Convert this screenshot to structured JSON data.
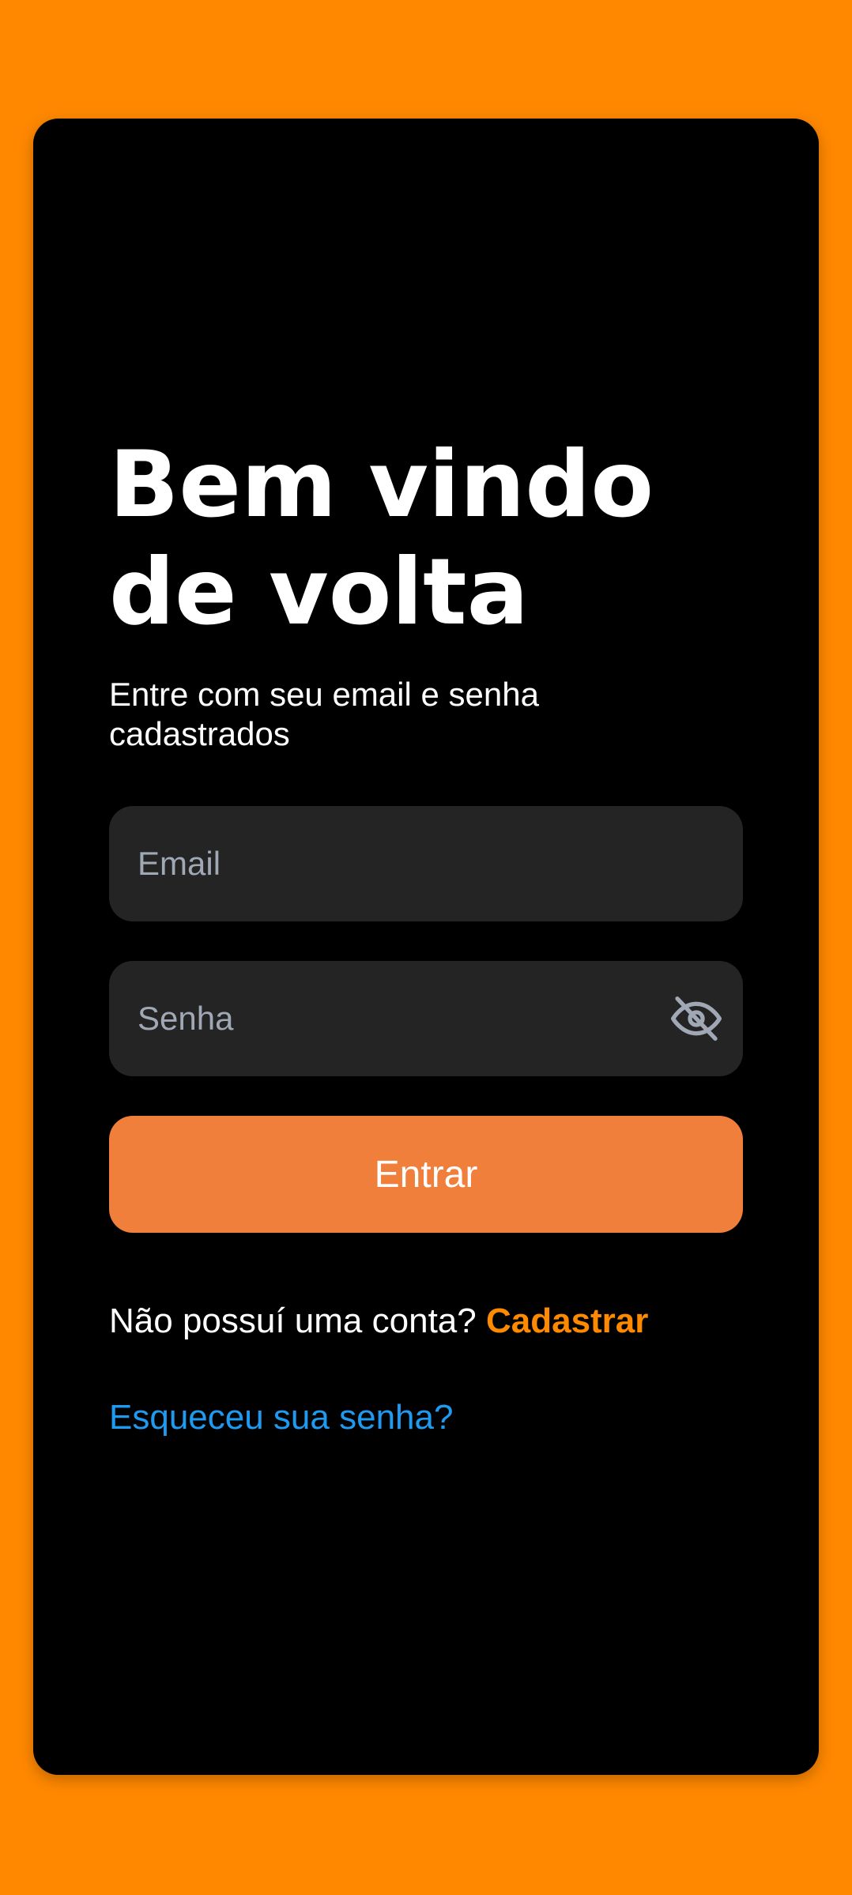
{
  "title": "Bem vindo de volta",
  "subtitle": "Entre com seu email e senha cadastrados",
  "email_field": {
    "placeholder": "Email",
    "value": ""
  },
  "password_field": {
    "placeholder": "Senha",
    "value": "",
    "toggle_icon": "eye-off-icon"
  },
  "login_button": {
    "label": "Entrar"
  },
  "signup": {
    "prompt": "Não possuí uma conta?",
    "link_label": "Cadastrar"
  },
  "forgot_password": {
    "label": "Esqueceu sua senha?"
  },
  "colors": {
    "background": "#FF8800",
    "card": "#000000",
    "input_bg": "#242424",
    "button": "#EF7F3A",
    "signup_link": "#FF8A00",
    "forgot_link": "#1E9BF0",
    "placeholder": "#A1A8B5"
  }
}
